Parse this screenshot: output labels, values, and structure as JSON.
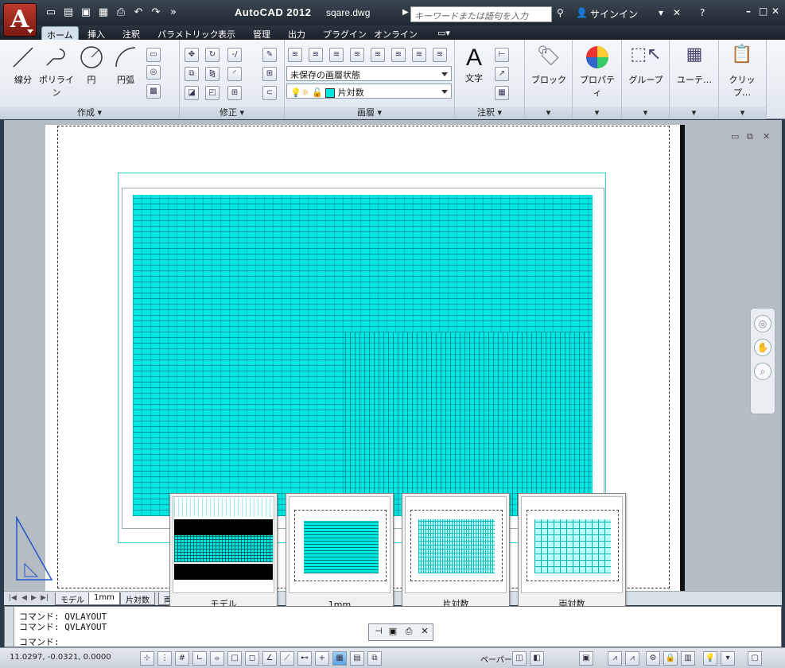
{
  "titlebar": {
    "app": "AutoCAD 2012",
    "file": "sqare.dwg",
    "search_placeholder": "キーワードまたは語句を入力",
    "signin": "サインイン"
  },
  "ribbon_tabs": [
    "ホーム",
    "挿入",
    "注釈",
    "パラメトリック",
    "表示",
    "管理",
    "出力",
    "プラグイン",
    "オンライン"
  ],
  "panels": {
    "draw": {
      "title": "作成",
      "tools": [
        "線分",
        "ポリライン",
        "円",
        "円弧"
      ]
    },
    "modify": {
      "title": "修正"
    },
    "layers": {
      "title": "画層",
      "layer_state": "未保存の画層状態",
      "current_layer": "片対数"
    },
    "annotation": {
      "title": "注釈",
      "text_label": "文字"
    },
    "block": {
      "label": "ブロック"
    },
    "properties": {
      "label": "プロパティ"
    },
    "group": {
      "label": "グループ"
    },
    "utilities": {
      "label": "ユーテ…"
    },
    "clipboard": {
      "label": "クリップ…"
    }
  },
  "layout_tabs": [
    "モデル",
    "1mm",
    "片対数",
    "両"
  ],
  "previews": [
    "モデル",
    "1mm",
    "片対数",
    "両対数"
  ],
  "command_lines": [
    "コマンド: QVLAYOUT",
    "コマンド: QVLAYOUT",
    "コマンド:"
  ],
  "status": {
    "coords": "11.0297, -0.0321, 0.0000",
    "space": "ペーパー"
  },
  "colors": {
    "grid": "#00e8e0",
    "accent": "#c0392b"
  }
}
